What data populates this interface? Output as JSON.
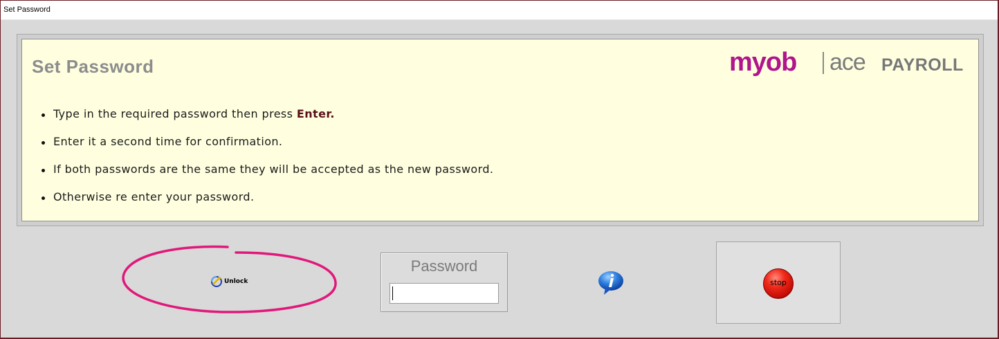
{
  "window": {
    "title": "Set Password"
  },
  "panel": {
    "title": "Set Password",
    "logo": {
      "brand": "myob",
      "product_prefix": "ace",
      "product_name": "PAYROLL"
    },
    "instructions": [
      {
        "text": "Type in the required password then press ",
        "emphasis": "Enter."
      },
      {
        "text": "Enter it a second time for confirmation.",
        "emphasis": ""
      },
      {
        "text": "If both passwords are the same they will be accepted as the new password.",
        "emphasis": ""
      },
      {
        "text": "Otherwise re enter your password.",
        "emphasis": ""
      }
    ]
  },
  "actions": {
    "unlock_label": "Unlock",
    "password_label": "Password",
    "password_value": "",
    "info_icon": "info-icon",
    "stop_label": "stop"
  },
  "colors": {
    "annotation": "#e0187a",
    "logo_magenta": "#b0158c",
    "emphasis": "#5a0f18",
    "panel_background": "#ffffe0",
    "window_border": "#6b1b24"
  }
}
